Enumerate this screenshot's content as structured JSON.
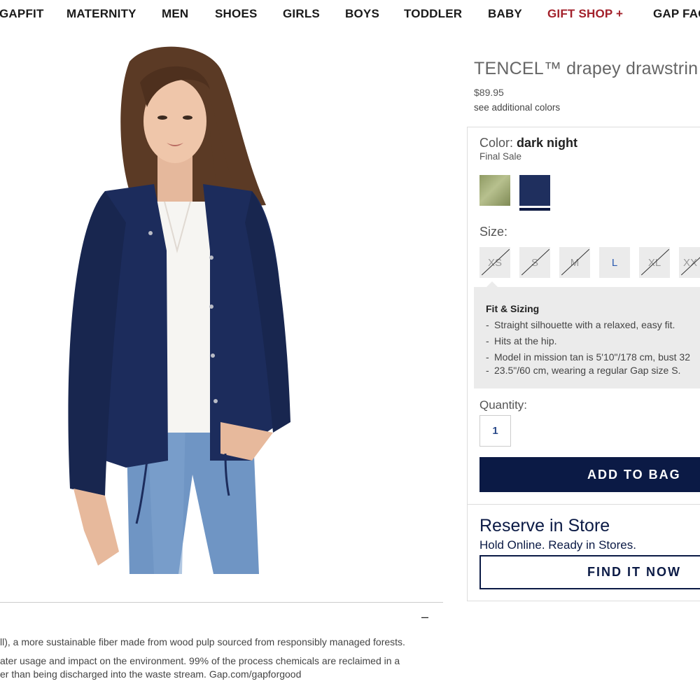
{
  "nav": {
    "items": [
      "GAPFIT",
      "MATERNITY",
      "MEN",
      "SHOES",
      "GIRLS",
      "BOYS",
      "TODDLER",
      "BABY",
      "GIFT SHOP +",
      "GAP FAC"
    ],
    "highlight_color": "#a3212b"
  },
  "product": {
    "title": "TENCEL™ drapey drawstrin",
    "price": "$89.95",
    "see_colors": "see additional colors"
  },
  "color": {
    "label": "Color:",
    "value": "dark night",
    "final_sale": "Final Sale",
    "swatches": [
      {
        "name": "olive",
        "color": "#8f9a63"
      },
      {
        "name": "dark night",
        "color": "#1f2f5e",
        "selected": true
      }
    ]
  },
  "size": {
    "label": "Size:",
    "options": [
      "XS",
      "S",
      "M",
      "L",
      "XL",
      "XX"
    ],
    "available": [
      "L"
    ]
  },
  "fit": {
    "title": "Fit & Sizing",
    "items": [
      "Straight silhouette with a relaxed, easy fit.",
      "Hits at the hip.",
      "Model in mission tan is 5'10\"/178 cm, bust 32",
      "23.5\"/60 cm, wearing a regular Gap size S."
    ]
  },
  "quantity": {
    "label": "Quantity:",
    "value": "1"
  },
  "buttons": {
    "add_to_bag": "ADD TO BAG",
    "find_it_now": "FIND IT NOW"
  },
  "reserve": {
    "title": "Reserve in Store",
    "subtitle": "Hold Online. Ready in Stores."
  },
  "details": {
    "toggle": "–",
    "lines": [
      "ll), a more sustainable fiber made from wood pulp sourced from responsibly managed forests.",
      "ater usage and impact on the environment. 99% of the process chemicals are reclaimed in a",
      "er than being discharged into the waste stream. Gap.com/gapforgood"
    ]
  },
  "colors": {
    "brand_navy": "#0b1a45",
    "link_blue": "#2b5bb0"
  }
}
